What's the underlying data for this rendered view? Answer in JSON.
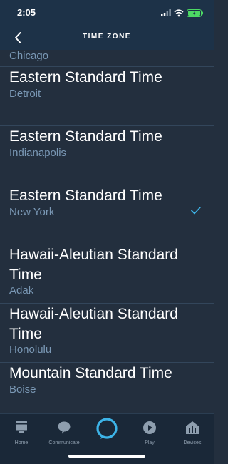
{
  "status_bar": {
    "time": "2:05"
  },
  "header": {
    "title": "TIME ZONE"
  },
  "list": {
    "partial_top": "Chicago",
    "items": [
      {
        "title": "Eastern Standard Time",
        "city": "Detroit",
        "selected": false
      },
      {
        "title": "Eastern Standard Time",
        "city": "Indianapolis",
        "selected": false
      },
      {
        "title": "Eastern Standard Time",
        "city": "New York",
        "selected": true
      },
      {
        "title": "Hawaii-Aleutian Standard Time",
        "city": "Adak",
        "selected": false
      },
      {
        "title": "Hawaii-Aleutian Standard Time",
        "city": "Honolulu",
        "selected": false
      },
      {
        "title": "Mountain Standard Time",
        "city": "Boise",
        "selected": false
      }
    ]
  },
  "tabbar": {
    "tabs": [
      {
        "label": "Home",
        "icon": "home-icon"
      },
      {
        "label": "Communicate",
        "icon": "chat-bubble-icon"
      },
      {
        "label": "",
        "icon": "alexa-icon"
      },
      {
        "label": "Play",
        "icon": "play-icon"
      },
      {
        "label": "Devices",
        "icon": "devices-icon"
      }
    ]
  },
  "colors": {
    "background": "#232f3e",
    "header": "#1d3248",
    "secondary_text": "#7a98b5",
    "accent": "#3db4e8",
    "battery": "#4cd964"
  }
}
